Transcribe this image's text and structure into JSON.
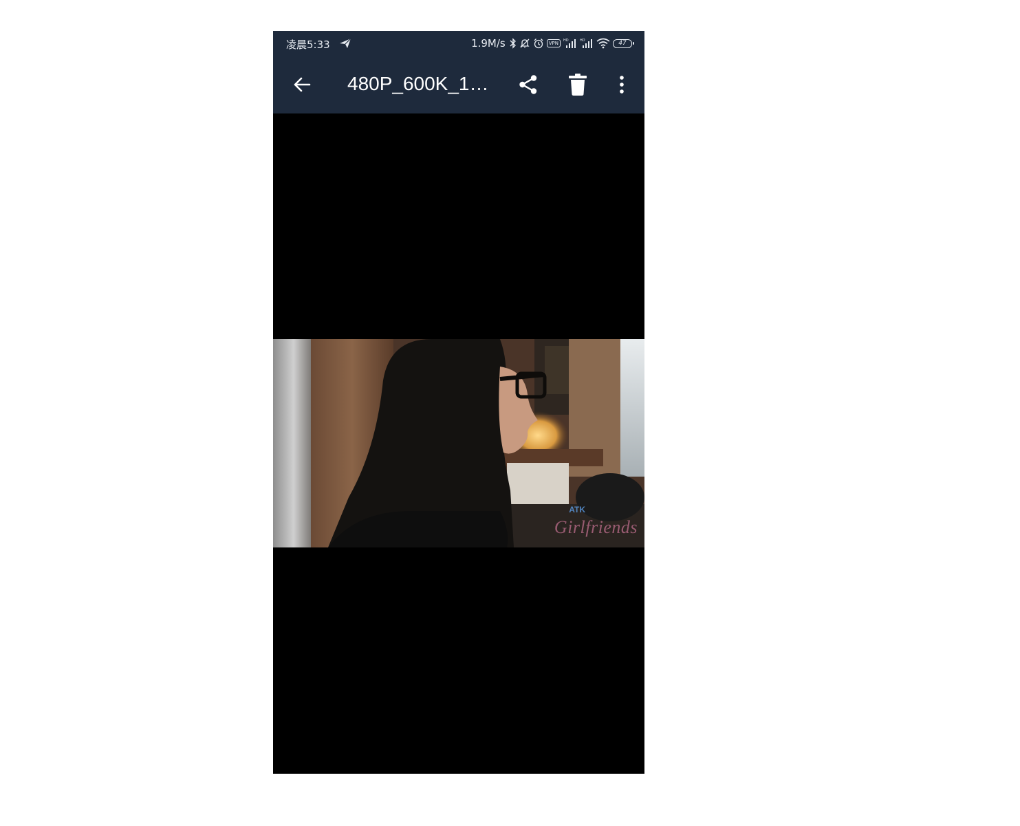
{
  "status_bar": {
    "time": "凌晨5:33",
    "network_speed": "1.9M/s",
    "vpn_label": "VPN",
    "battery_level": "47",
    "icons": [
      "send-icon",
      "bluetooth-icon",
      "mute-icon",
      "alarm-icon",
      "vpn-icon",
      "signal-icon",
      "signal-icon",
      "wifi-icon",
      "battery-icon"
    ]
  },
  "app_bar": {
    "title": "480P_600K_1…",
    "icons": [
      "back-arrow-icon",
      "share-icon",
      "delete-icon",
      "more-vert-icon"
    ],
    "background": "#1e2a3c"
  },
  "video": {
    "watermark_top": "ATK",
    "watermark_bottom": "Girlfriends"
  }
}
